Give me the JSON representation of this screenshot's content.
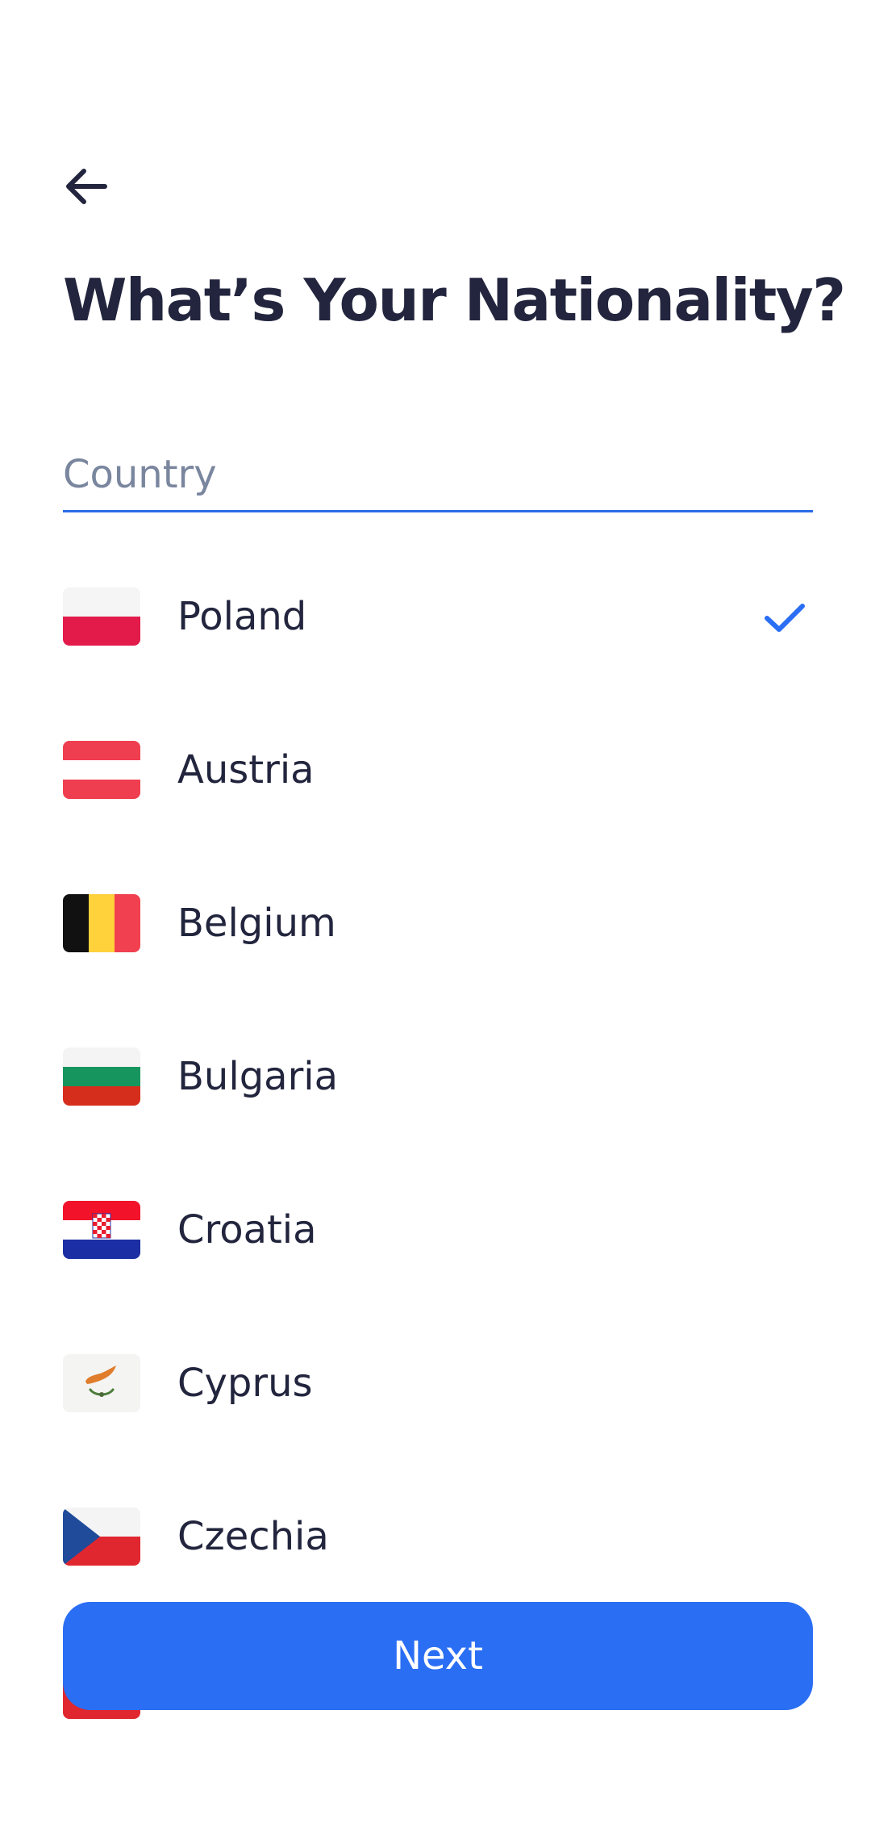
{
  "header": {
    "back_icon": "arrow-left-icon",
    "title": "What’s Your Nationality?"
  },
  "search": {
    "placeholder": "Country",
    "value": "",
    "underline_color": "#2a6ce8"
  },
  "countries": [
    {
      "name": "Poland",
      "flag_icon": "poland-flag-icon",
      "selected": true
    },
    {
      "name": "Austria",
      "flag_icon": "austria-flag-icon",
      "selected": false
    },
    {
      "name": "Belgium",
      "flag_icon": "belgium-flag-icon",
      "selected": false
    },
    {
      "name": "Bulgaria",
      "flag_icon": "bulgaria-flag-icon",
      "selected": false
    },
    {
      "name": "Croatia",
      "flag_icon": "croatia-flag-icon",
      "selected": false
    },
    {
      "name": "Cyprus",
      "flag_icon": "cyprus-flag-icon",
      "selected": false
    },
    {
      "name": "Czechia",
      "flag_icon": "czechia-flag-icon",
      "selected": false
    }
  ],
  "selection": {
    "check_icon": "checkmark-icon",
    "check_color": "#2a6ef4"
  },
  "footer": {
    "next_label": "Next",
    "button_color": "#2a6ef4"
  },
  "colors": {
    "text": "#22253d",
    "placeholder": "#7a869e",
    "accent": "#2a6ef4"
  }
}
